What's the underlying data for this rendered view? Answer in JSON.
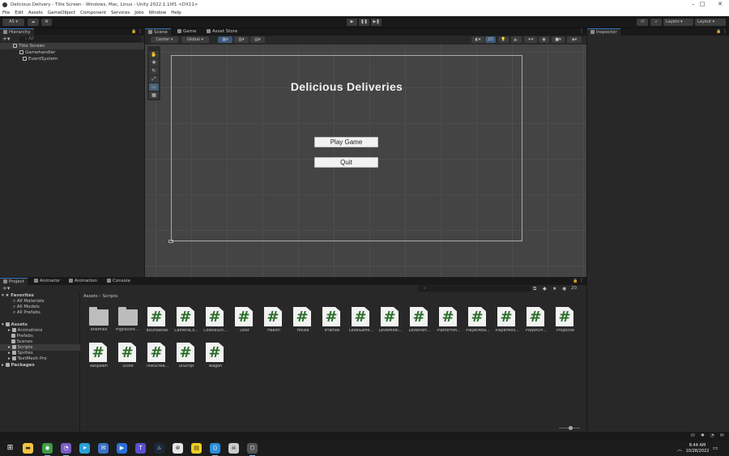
{
  "window": {
    "title": "Delicious Delivery - Title Screen - Windows, Mac, Linux - Unity 2022.1.10f1 <DX11>",
    "minimize": "–",
    "maximize": "□",
    "close": "✕"
  },
  "menu": [
    "File",
    "Edit",
    "Assets",
    "GameObject",
    "Component",
    "Services",
    "Jobs",
    "Window",
    "Help"
  ],
  "toolbar": {
    "account": "AS ▾",
    "play": "▶",
    "pause": "❚❚",
    "step": "▶❚",
    "layers": "Layers",
    "layout": "Layout"
  },
  "hierarchy": {
    "tab": "Hierarchy",
    "search_placeholder": "All",
    "items": [
      {
        "label": "Title Screen",
        "indent": 0,
        "icon": "scene-icon"
      },
      {
        "label": "Gamehandler",
        "indent": 1,
        "icon": "cube-icon"
      },
      {
        "label": "EventSystem",
        "indent": 1,
        "icon": "cube-icon"
      }
    ]
  },
  "scene": {
    "tabs": [
      "Scene",
      "Game",
      "Asset Store"
    ],
    "pivot": "Center",
    "space": "Global",
    "mode_2d": "2D",
    "game_title": "Delicious Deliveries",
    "play_button": "Play Game",
    "quit_button": "Quit"
  },
  "inspector": {
    "tab": "Inspector"
  },
  "project": {
    "tabs": [
      "Project",
      "Animator",
      "Animation",
      "Console"
    ],
    "favorites_label": "Favorites",
    "favorites": [
      "All Materials",
      "All Models",
      "All Prefabs"
    ],
    "assets_label": "Assets",
    "asset_folders": [
      "Animations",
      "Prefabs",
      "Scenes",
      "Scripts",
      "Sprites",
      "TextMesh Pro"
    ],
    "packages_label": "Packages",
    "breadcrumb": [
      "Assets",
      "Scripts"
    ],
    "hidden_count": "20",
    "items": [
      {
        "name": "enemies",
        "kind": "folder"
      },
      {
        "name": "Highscore ...",
        "kind": "folder"
      },
      {
        "name": "Boundaries",
        "kind": "script"
      },
      {
        "name": "CameraCo...",
        "kind": "script"
      },
      {
        "name": "CookieScri...",
        "kind": "script"
      },
      {
        "name": "Door",
        "kind": "script"
      },
      {
        "name": "Health",
        "kind": "script"
      },
      {
        "name": "House",
        "kind": "script"
      },
      {
        "name": "IFrames",
        "kind": "script"
      },
      {
        "name": "LevelGene...",
        "kind": "script"
      },
      {
        "name": "LevelModi...",
        "kind": "script"
      },
      {
        "name": "LevelPart...",
        "kind": "script"
      },
      {
        "name": "PlatformM...",
        "kind": "script"
      },
      {
        "name": "PlayerAtta...",
        "kind": "script"
      },
      {
        "name": "PlayerMov...",
        "kind": "script"
      },
      {
        "name": "PlayerUn...",
        "kind": "script"
      },
      {
        "name": "Projectile",
        "kind": "script"
      },
      {
        "name": "Respawn",
        "kind": "script"
      },
      {
        "name": "Score",
        "kind": "script"
      },
      {
        "name": "TitleScree...",
        "kind": "script"
      },
      {
        "name": "UIScript",
        "kind": "script"
      },
      {
        "name": "Wagon",
        "kind": "script"
      }
    ]
  },
  "taskbar": {
    "time": "8:44 AM",
    "date": "10/28/2022"
  },
  "colors": {
    "panel": "#282828",
    "scene_bg": "#444444",
    "accent": "#3a79bb",
    "script_hash": "#2c6d2c"
  }
}
